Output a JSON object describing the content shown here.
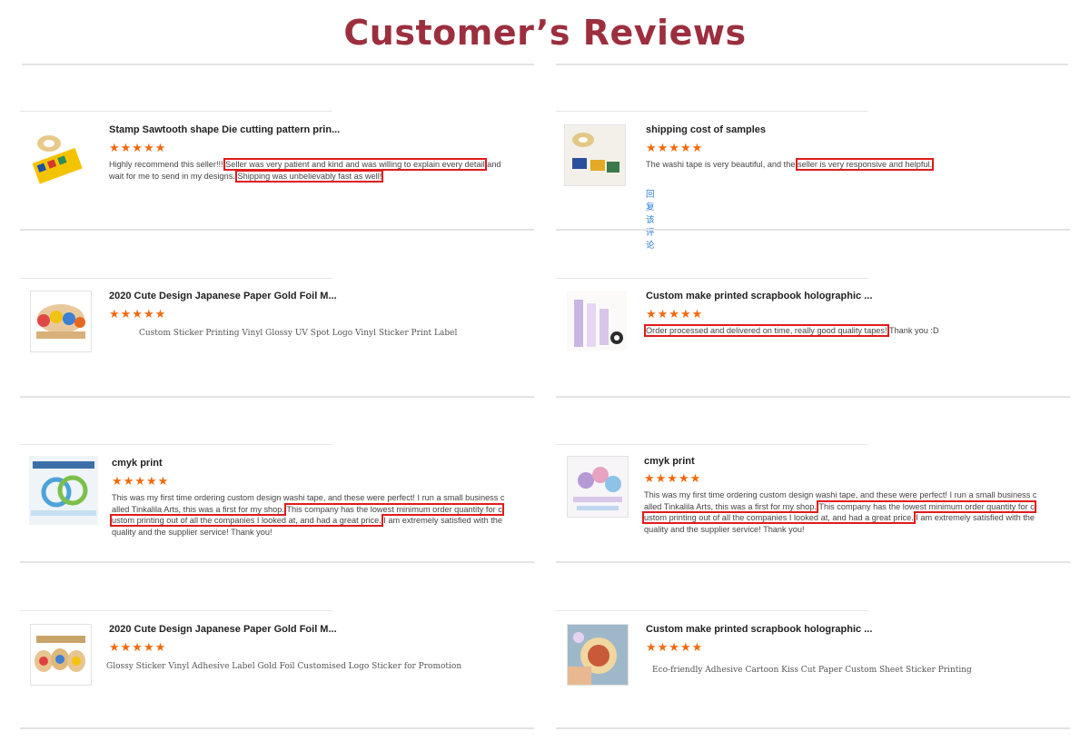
{
  "page_title": "Customer’s  Reviews",
  "colors": {
    "title": "#9c2f3e",
    "stars": "#f06a0f",
    "highlight": "#e01b1b",
    "link": "#2a7fd4"
  },
  "star_icon": "star-icon",
  "reviews": [
    {
      "title": "Stamp Sawtooth shape Die cutting pattern prin...",
      "rating": 5,
      "stars": "★★★★★",
      "text_parts": [
        "Highly recommend this seller!!! ",
        "Seller was very patient and kind and was willing to explain every detail",
        " and wait for me to send in my designs. ",
        "Shipping was unbelievably fast as well!"
      ]
    },
    {
      "title": "shipping cost of samples",
      "rating": 5,
      "stars": "★★★★★",
      "text_parts": [
        "The washi tape is very beautiful, and the ",
        "seller is very responsive and helpful."
      ],
      "reply": "回复该评论"
    },
    {
      "title": "2020 Cute Design Japanese Paper Gold Foil M...",
      "rating": 5,
      "stars": "★★★★★",
      "product_name": "Custom Sticker Printing Vinyl Glossy UV Spot Logo Vinyl Sticker Print Label"
    },
    {
      "title": "Custom make printed scrapbook holographic ...",
      "rating": 5,
      "stars": "★★★★★",
      "text_parts": [
        "Order processed and delivered on time, really good quality tapes!",
        " Thank you :D"
      ]
    },
    {
      "title": "cmyk print",
      "rating": 5,
      "stars": "★★★★★",
      "text_parts": [
        "This was my first time ordering custom design washi tape, and these were perfect! I run a small business c alled Tinkalila Arts, this was a first for my shop. ",
        "This company has the lowest minimum order quantity for c ustom printing out of all the companies I looked at, and had a great price.",
        " I am extremely satisfied with the quality and the supplier service! Thank you!"
      ]
    },
    {
      "title": "cmyk print",
      "rating": 5,
      "stars": "★★★★★",
      "text_parts": [
        "This was my first time ordering custom design washi tape, and these were perfect! I run a small business c alled Tinkalila Arts, this was a first for my shop. ",
        "This company has the lowest minimum order quantity for c ustom printing out of all the companies I looked at, and had a great price.",
        " I am extremely satisfied with the quality and the supplier service! Thank you!"
      ]
    },
    {
      "title": "2020 Cute Design Japanese Paper Gold Foil M...",
      "rating": 5,
      "stars": "★★★★★",
      "product_name": "Glossy Sticker Vinyl Adhesive Label Gold Foil Customised Logo Sticker for Promotion"
    },
    {
      "title": "Custom make printed scrapbook holographic ...",
      "rating": 5,
      "stars": "★★★★★",
      "product_name": "Eco-friendly Adhesive Cartoon Kiss Cut Paper Custom Sheet Sticker Printing"
    }
  ]
}
